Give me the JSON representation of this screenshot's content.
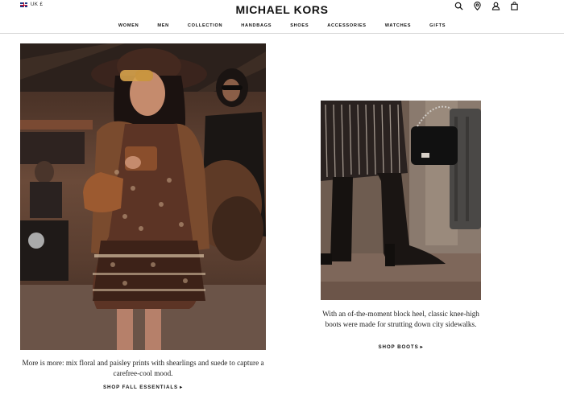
{
  "header": {
    "locale": "UK £",
    "brand": "MICHAEL KORS",
    "icons": [
      "search-icon",
      "location-icon",
      "account-icon",
      "bag-icon"
    ]
  },
  "nav": {
    "items": [
      "WOMEN",
      "MEN",
      "COLLECTION",
      "HANDBAGS",
      "SHOES",
      "ACCESSORIES",
      "WATCHES",
      "GIFTS"
    ]
  },
  "promos": [
    {
      "caption": "More is more: mix floral and paisley prints with shearlings and suede to capture a carefree-cool mood.",
      "cta": "SHOP FALL ESSENTIALS",
      "cta_icon": "chevron-right-icon"
    },
    {
      "caption": "With an of-the-moment block heel, classic knee-high boots were made for strutting down city sidewalks.",
      "cta": "SHOP BOOTS",
      "cta_icon": "chevron-right-icon"
    }
  ],
  "colors": {
    "text": "#111111",
    "divider": "#d9d9d9",
    "background": "#ffffff"
  }
}
